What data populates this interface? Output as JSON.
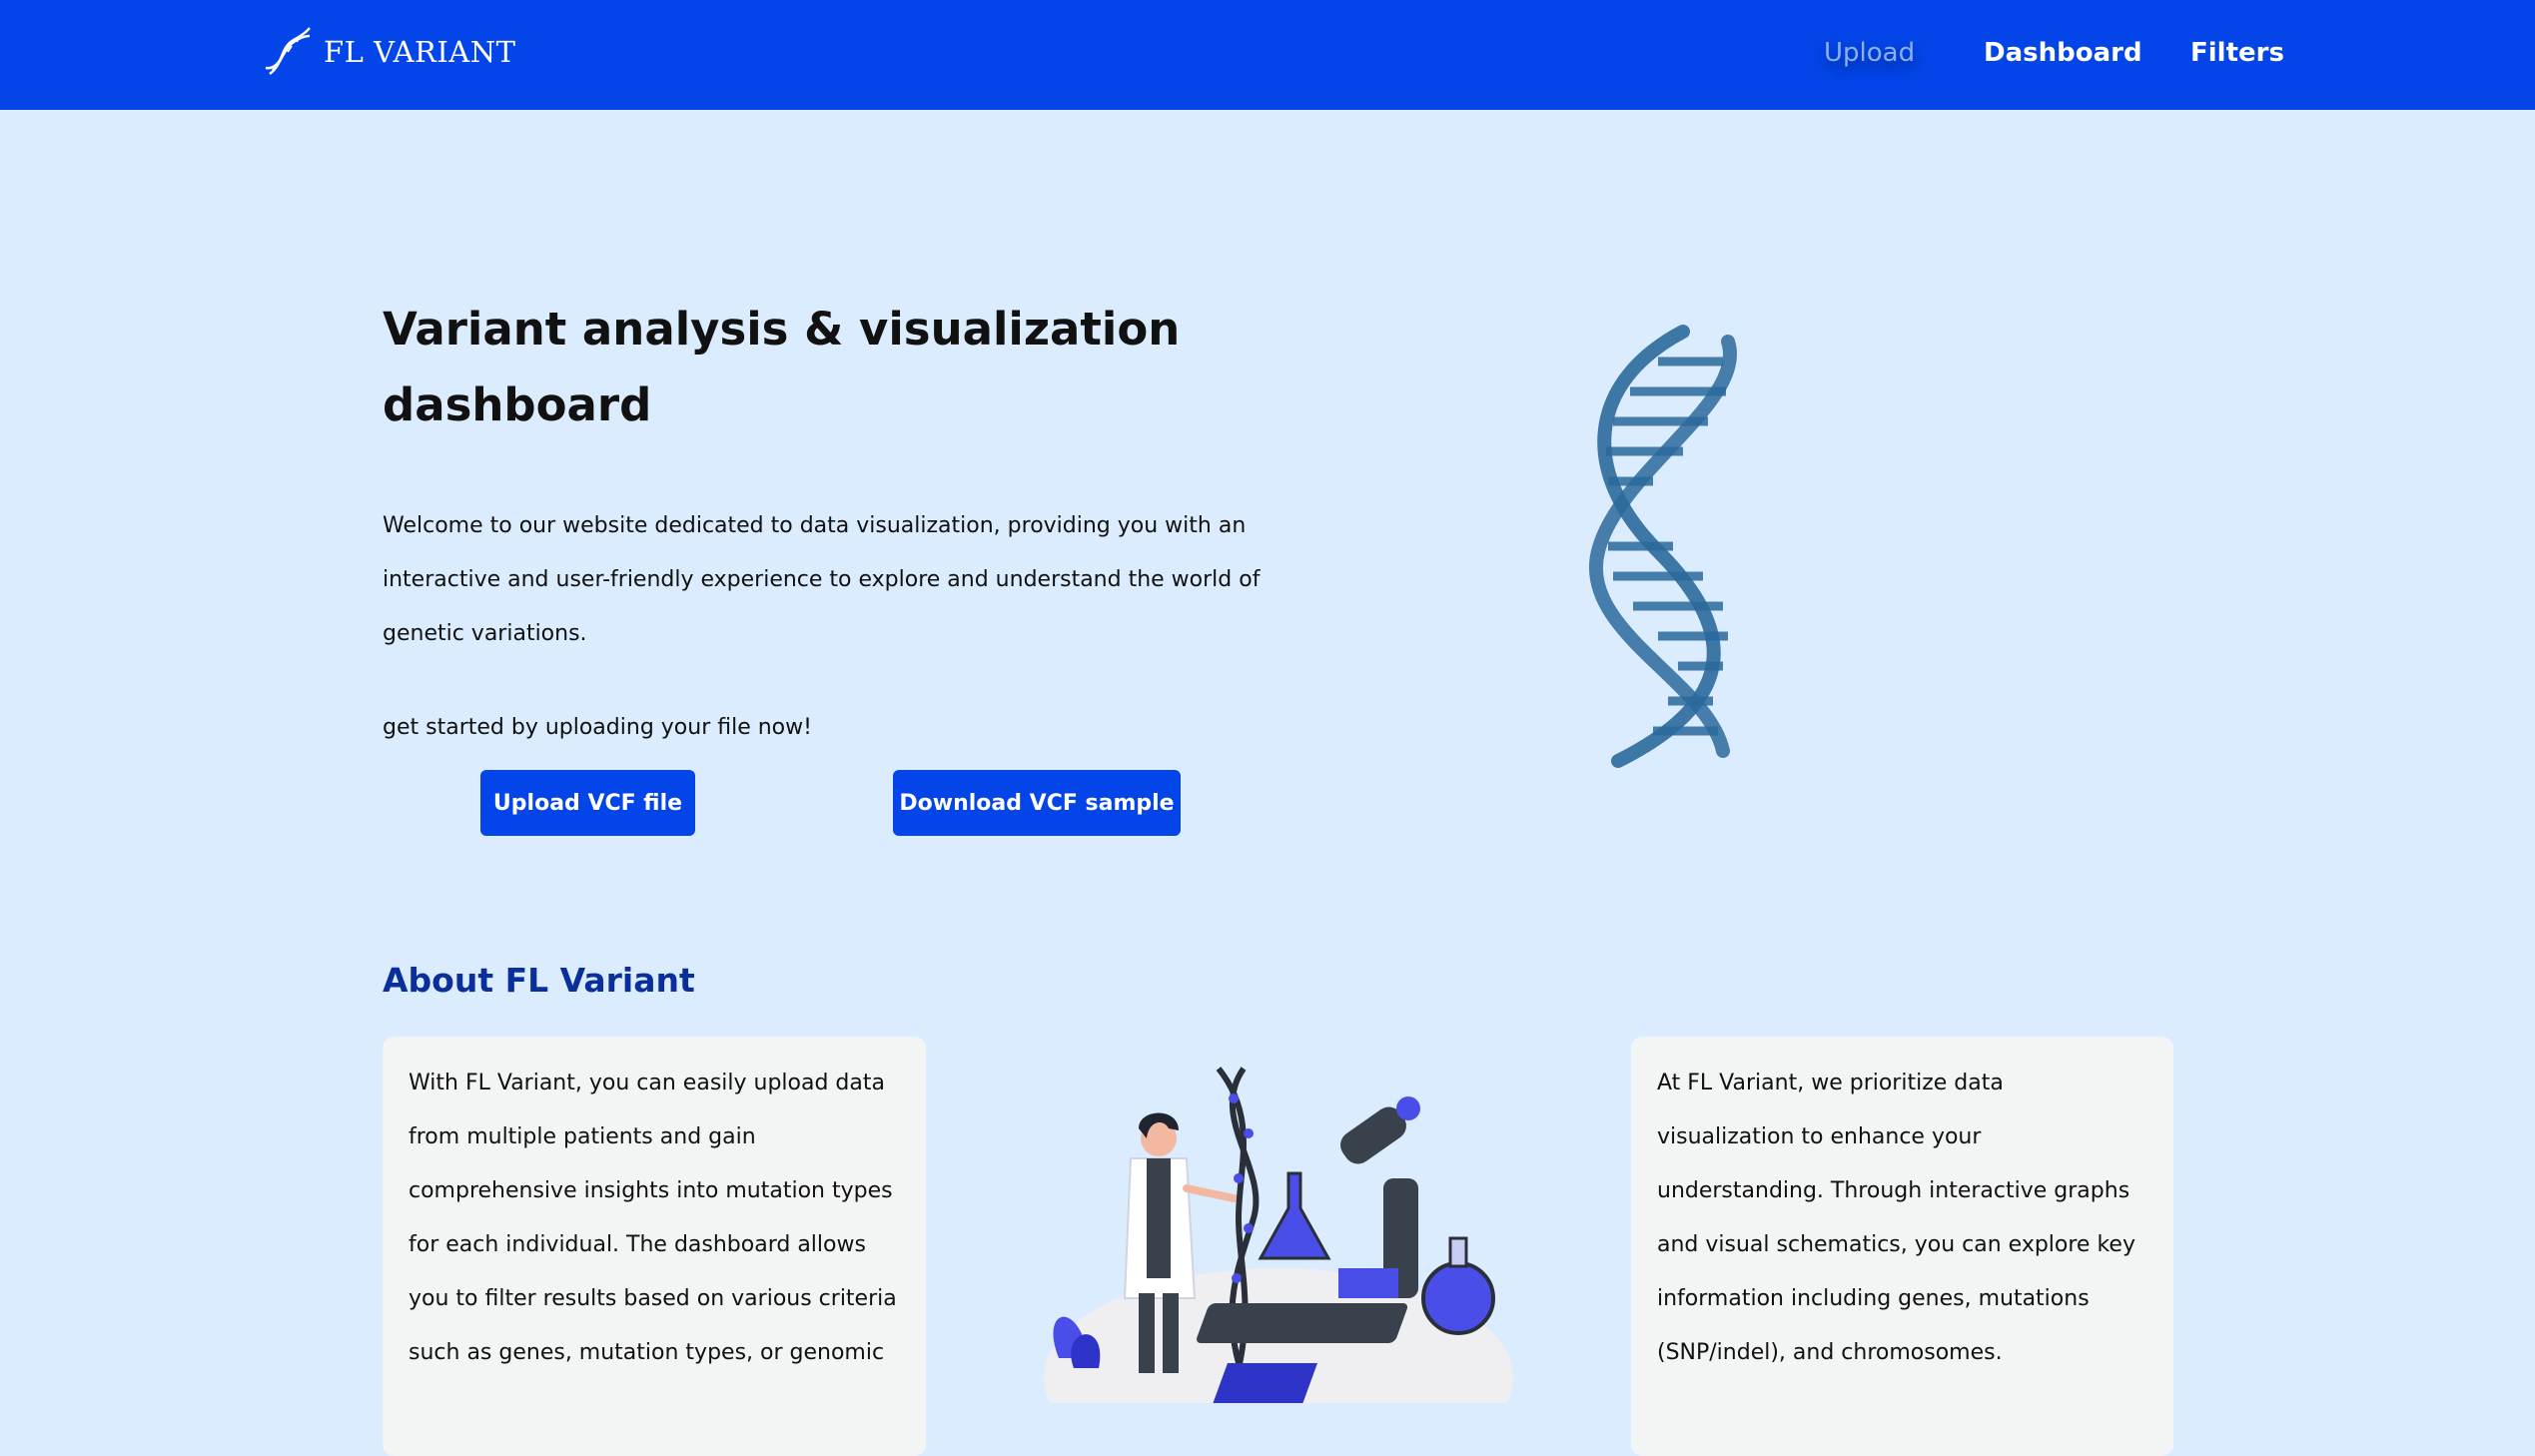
{
  "navbar": {
    "logo_text": "FL VARIANT",
    "links": [
      "Upload",
      "Dashboard",
      "Filters"
    ],
    "background": "#0345e8"
  },
  "hero": {
    "title": "Variant analysis & visualization dashboard",
    "description": "Welcome to our website dedicated to data visualization, providing you with an interactive and user-friendly experience to explore and understand the world of genetic variations.",
    "cta": "get started by uploading your file now!",
    "upload_button": "Upload VCF file",
    "download_button": "Download VCF sample"
  },
  "about": {
    "title": "About FL Variant",
    "left_card": "With FL Variant, you can easily upload data from multiple patients and gain comprehensive insights into mutation types for each individual. The dashboard allows you to filter results based on various criteria such as genes, mutation types, or genomic",
    "right_card": "At FL Variant, we prioritize data visualization to enhance your understanding. Through interactive graphs and visual schematics, you can explore key information including genes, mutations (SNP/indel), and chromosomes."
  },
  "colors": {
    "page_background": "#dbecfe",
    "accent": "#0345e8",
    "about_title": "#0a2f9c",
    "card_background": "#f3f4f4"
  }
}
